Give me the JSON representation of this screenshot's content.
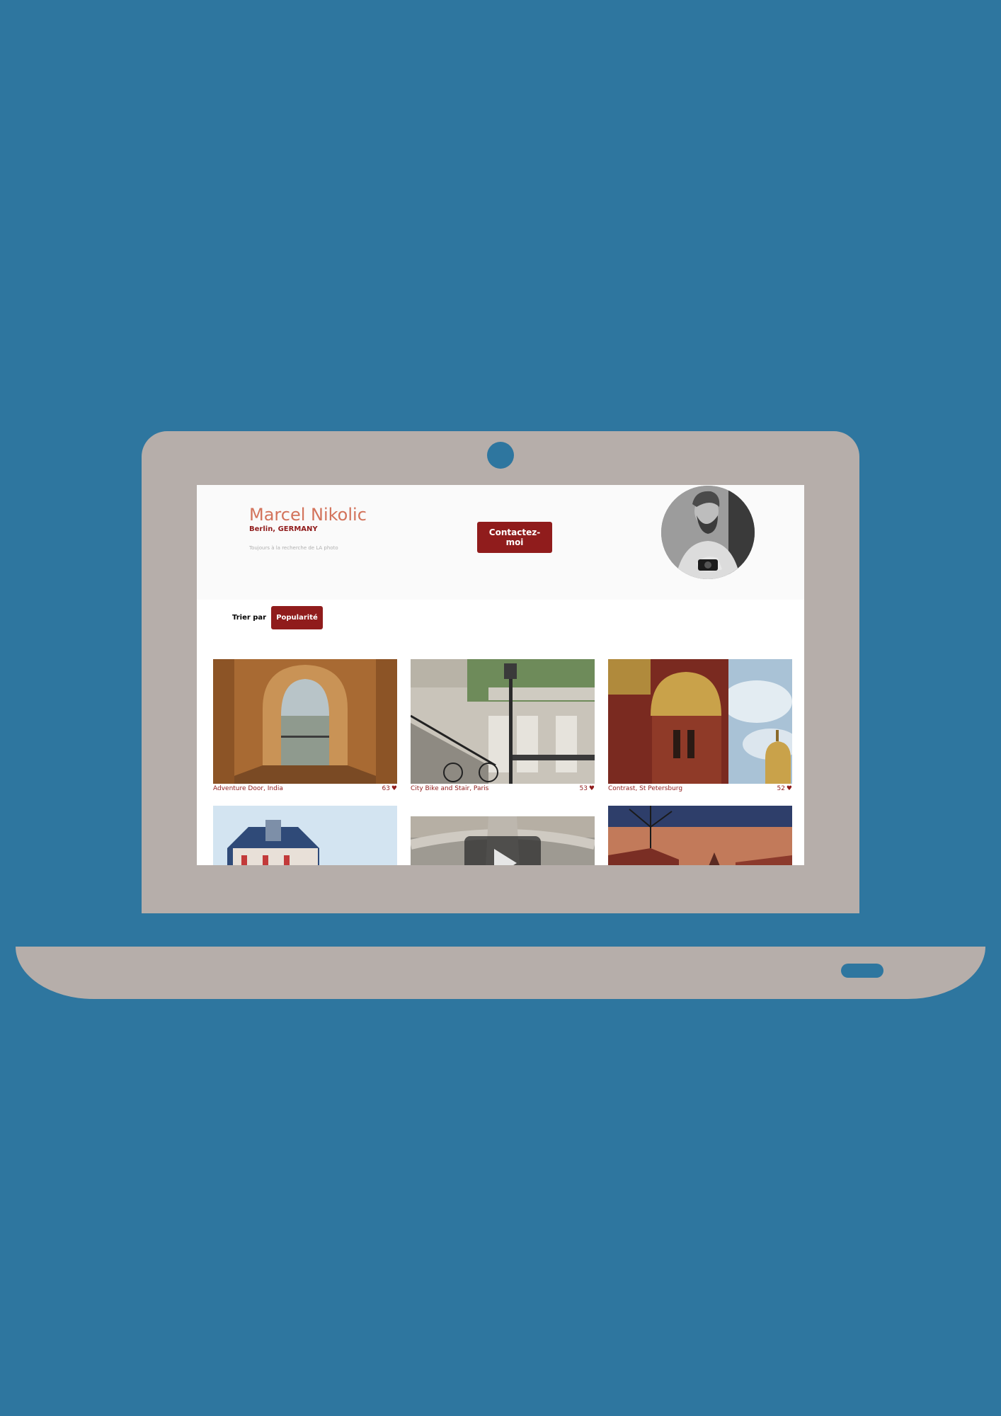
{
  "photographer": {
    "name": "Marcel Nikolic",
    "location": "Berlin, GERMANY",
    "tagline": "Toujours à la recherche de LA photo",
    "contact_label": "Contactez-moi",
    "avatar_icon": "bearded-man-with-camera-portrait"
  },
  "sort": {
    "label": "Trier par",
    "selected": "Popularité"
  },
  "media": [
    {
      "title": "Adventure Door, India",
      "likes": "63",
      "like_icon": "heart-icon"
    },
    {
      "title": "City Bike and Stair, Paris",
      "likes": "53",
      "like_icon": "heart-icon"
    },
    {
      "title": "Contrast, St Petersburg",
      "likes": "52",
      "like_icon": "heart-icon"
    },
    {
      "title": "",
      "likes": ""
    },
    {
      "title": "",
      "likes": ""
    },
    {
      "title": "",
      "likes": ""
    }
  ],
  "colors": {
    "background": "#2E769F",
    "laptop": "#B6AEAA",
    "accent": "#901C1C",
    "name": "#D3735B",
    "header_bg": "#FAFAFA"
  }
}
